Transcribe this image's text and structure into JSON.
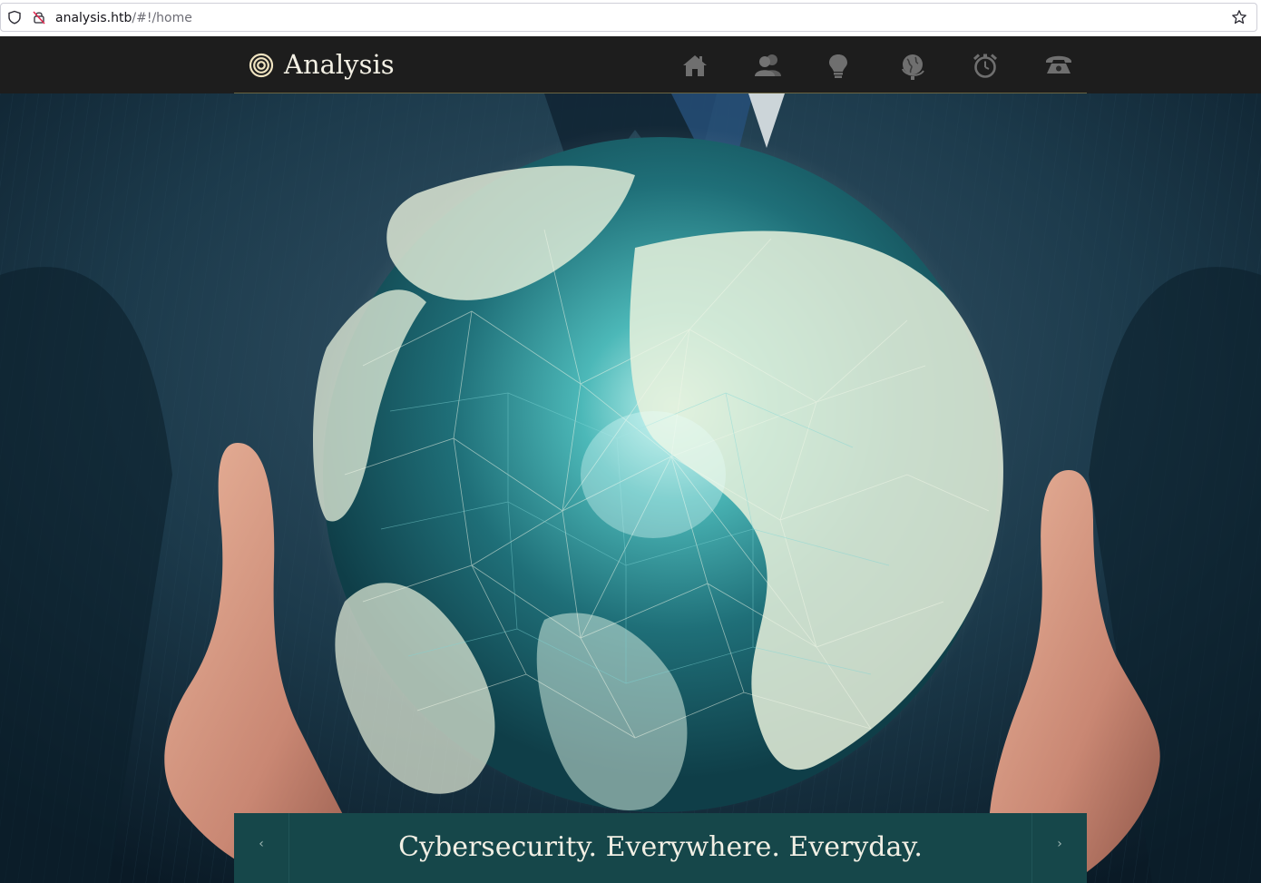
{
  "browser": {
    "url_host": "analysis.htb",
    "url_path": "/#!/home",
    "icons": [
      "shield-icon",
      "insecure-lock-icon",
      "bookmark-star-icon"
    ]
  },
  "site": {
    "brand": "Analysis",
    "logo_icon": "target-rings-icon",
    "nav": [
      {
        "name": "home",
        "icon": "house-icon"
      },
      {
        "name": "about",
        "icon": "people-icon"
      },
      {
        "name": "ideas",
        "icon": "lightbulb-icon"
      },
      {
        "name": "world",
        "icon": "globe-icon"
      },
      {
        "name": "schedule",
        "icon": "alarm-clock-icon"
      },
      {
        "name": "contact",
        "icon": "telephone-icon"
      }
    ]
  },
  "hero": {
    "caption": "Cybersecurity. Everywhere. Everyday.",
    "prev_label": "‹",
    "next_label": "›"
  },
  "colors": {
    "navbar_bg": "#1d1d1d",
    "nav_icon": "#6f6f6f",
    "caption_bg": "#16474a",
    "accent_line": "#6b6440",
    "globe_glow": "#cfe9d8",
    "globe_teal": "#3fb7b8"
  }
}
